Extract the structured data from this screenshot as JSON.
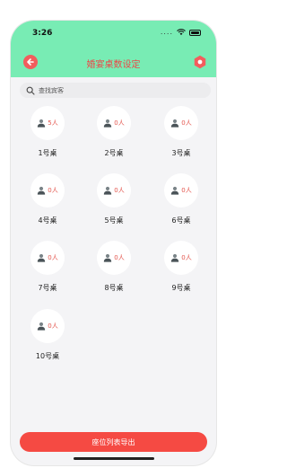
{
  "status": {
    "time": "3:26",
    "signal": "...."
  },
  "header": {
    "title": "婚宴桌数设定",
    "back_icon": "back-arrow-icon",
    "settings_icon": "settings-icon",
    "accent": "#78ecb4",
    "title_color": "#ec4848"
  },
  "search": {
    "placeholder": "查找宾客",
    "value": ""
  },
  "tables": [
    {
      "name": "1号桌",
      "count": "5人"
    },
    {
      "name": "2号桌",
      "count": "0人"
    },
    {
      "name": "3号桌",
      "count": "0人"
    },
    {
      "name": "4号桌",
      "count": "0人"
    },
    {
      "name": "5号桌",
      "count": "0人"
    },
    {
      "name": "6号桌",
      "count": "0人"
    },
    {
      "name": "7号桌",
      "count": "0人"
    },
    {
      "name": "8号桌",
      "count": "0人"
    },
    {
      "name": "9号桌",
      "count": "0人"
    },
    {
      "name": "10号桌",
      "count": "0人"
    }
  ],
  "footer": {
    "export_label": "座位列表导出",
    "button_color": "#f54a43"
  }
}
